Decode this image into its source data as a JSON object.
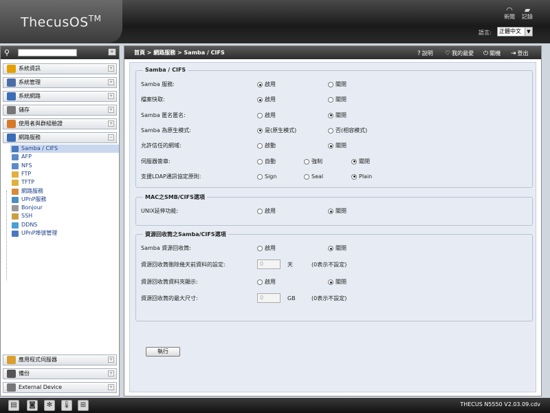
{
  "header": {
    "logo": "ThecusOS",
    "logo_tm": "TM",
    "news_label": "新聞",
    "log_label": "記錄",
    "language_label": "語言:",
    "language_value": "正體中文"
  },
  "sidebar": {
    "menu_top": [
      {
        "label": "系統資訊",
        "icon": "info-icon",
        "color": "#e4a100"
      },
      {
        "label": "系統管理",
        "icon": "tools-icon",
        "color": "#4a6fa8"
      },
      {
        "label": "系統網路",
        "icon": "network-icon",
        "color": "#3b6db5"
      },
      {
        "label": "儲存",
        "icon": "storage-icon",
        "color": "#777777"
      },
      {
        "label": "使用者與群組驗證",
        "icon": "users-icon",
        "color": "#d47a2a"
      },
      {
        "label": "網路服務",
        "icon": "network-service-icon",
        "color": "#3b6db5"
      }
    ],
    "sub_items": [
      {
        "label": "Samba / CIFS",
        "icon": "samba-icon",
        "color": "#4a78c0"
      },
      {
        "label": "AFP",
        "icon": "afp-icon",
        "color": "#5c8bc9"
      },
      {
        "label": "NFS",
        "icon": "nfs-icon",
        "color": "#5c8bc9"
      },
      {
        "label": "FTP",
        "icon": "ftp-icon",
        "color": "#e0b040"
      },
      {
        "label": "TFTP",
        "icon": "tftp-icon",
        "color": "#e0b040"
      },
      {
        "label": "網路服務",
        "icon": "web-service-icon",
        "color": "#d88a3a"
      },
      {
        "label": "UPnP服務",
        "icon": "upnp-icon",
        "color": "#4a90c0"
      },
      {
        "label": "Bonjour",
        "icon": "bonjour-icon",
        "color": "#9a9a9a"
      },
      {
        "label": "SSH",
        "icon": "ssh-icon",
        "color": "#c9a040"
      },
      {
        "label": "DDNS",
        "icon": "ddns-icon",
        "color": "#4aa0d0"
      },
      {
        "label": "UPnP埠號管理",
        "icon": "upnp-port-icon",
        "color": "#4a78c0"
      }
    ],
    "menu_bottom": [
      {
        "label": "應用程式伺服器",
        "icon": "app-server-icon",
        "color": "#d8a030"
      },
      {
        "label": "備份",
        "icon": "backup-icon",
        "color": "#555555"
      },
      {
        "label": "External Device",
        "icon": "external-device-icon",
        "color": "#777777"
      }
    ]
  },
  "topbar": {
    "breadcrumb": "首頁 > 網路服務 > Samba / CIFS",
    "help": "說明",
    "favorites": "我的最愛",
    "shutdown": "關機",
    "logout": "登出"
  },
  "samba": {
    "title": "Samba / CIFS",
    "rows": [
      {
        "label": "Samba 服務:",
        "options": [
          "啟用",
          "關閉"
        ],
        "selected": 0
      },
      {
        "label": "檔案快取:",
        "options": [
          "啟用",
          "關閉"
        ],
        "selected": 0
      },
      {
        "label": "Samba 匿名匿名:",
        "options": [
          "啟用",
          "關閉"
        ],
        "selected": 1
      },
      {
        "label": "Samba 為原生模式:",
        "options": [
          "是(原生模式)",
          "否(相容模式)"
        ],
        "selected": 0
      },
      {
        "label": "允許信任的網域:",
        "options": [
          "啟動",
          "關閉"
        ],
        "selected": 1
      },
      {
        "label": "伺服器簽章:",
        "options": [
          "自動",
          "強制",
          "關閉"
        ],
        "selected": 2
      },
      {
        "label": "支援LDAP通訊協定原則:",
        "options": [
          "Sign",
          "Seal",
          "Plain"
        ],
        "selected": 2
      }
    ]
  },
  "mac": {
    "title": "MAC之SMB/CIFS選項",
    "rows": [
      {
        "label": "UNIX延伸功能:",
        "options": [
          "啟用",
          "關閉"
        ],
        "selected": 1
      }
    ]
  },
  "recycle": {
    "title": "資源回收筒之Samba/CIFS選項",
    "bin_label": "Samba 資源回收筒:",
    "bin_options": [
      "啟用",
      "關閉"
    ],
    "bin_selected": 1,
    "days_label": "資源回收筒刪除幾天前資料的設定:",
    "days_value": "0",
    "days_unit": "天",
    "days_note": "(0表示不設定)",
    "folder_label": "資源回收筒資料夾顯示:",
    "folder_options": [
      "啟用",
      "關閉"
    ],
    "folder_selected": 1,
    "size_label": "資源回收筒的最大尺寸:",
    "size_value": "0",
    "size_unit": "GB",
    "size_note": "(0表示不設定)"
  },
  "execute_label": "執行",
  "footer": {
    "version": "THECUS N5550 V2.03.09.cdv"
  }
}
